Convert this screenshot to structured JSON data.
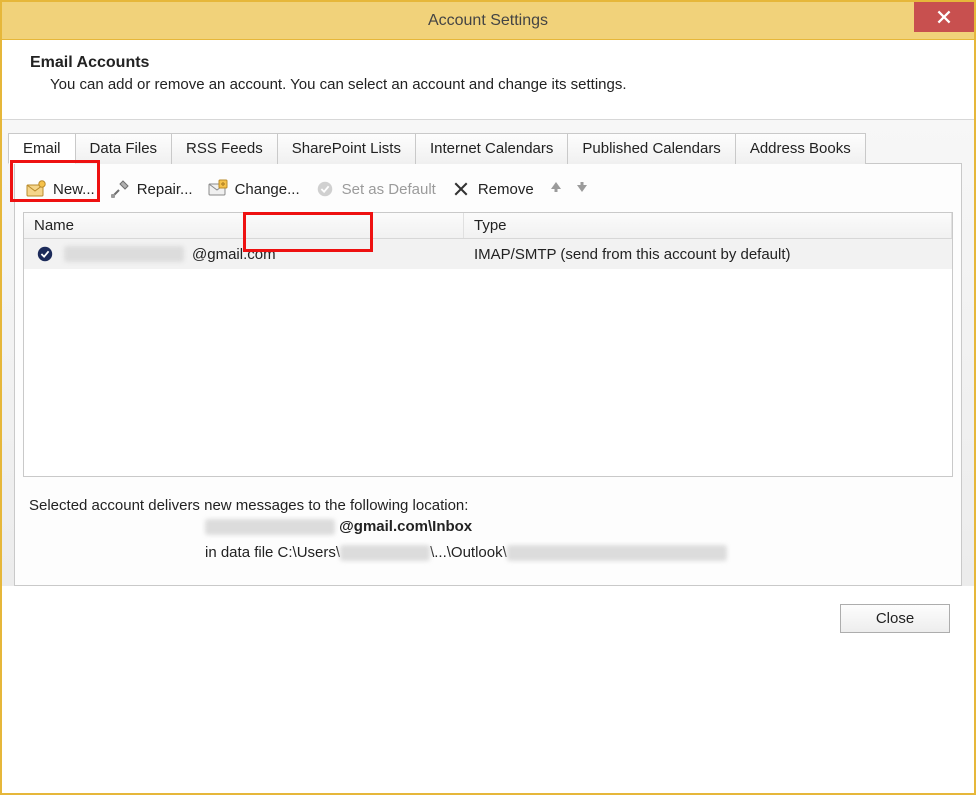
{
  "window": {
    "title": "Account Settings"
  },
  "header": {
    "title": "Email Accounts",
    "subtitle": "You can add or remove an account. You can select an account and change its settings."
  },
  "tabs": [
    {
      "id": "email",
      "label": "Email",
      "active": true
    },
    {
      "id": "data-files",
      "label": "Data Files",
      "active": false
    },
    {
      "id": "rss-feeds",
      "label": "RSS Feeds",
      "active": false
    },
    {
      "id": "sharepoint-lists",
      "label": "SharePoint Lists",
      "active": false
    },
    {
      "id": "internet-calendars",
      "label": "Internet Calendars",
      "active": false
    },
    {
      "id": "published-calendars",
      "label": "Published Calendars",
      "active": false
    },
    {
      "id": "address-books",
      "label": "Address Books",
      "active": false
    }
  ],
  "toolbar": {
    "new_label": "New...",
    "repair_label": "Repair...",
    "change_label": "Change...",
    "set_default_label": "Set as Default",
    "remove_label": "Remove"
  },
  "columns": {
    "name": "Name",
    "type": "Type"
  },
  "accounts": [
    {
      "name_visible_suffix": "@gmail.com",
      "type": "IMAP/SMTP (send from this account by default)",
      "is_default": true
    }
  ],
  "delivery": {
    "intro": "Selected account delivers new messages to the following location:",
    "location_middle": "@gmail.com\\Inbox",
    "datafile_prefix": "in data file C:\\Users\\",
    "datafile_middle": "\\...\\Outlook\\"
  },
  "footer": {
    "close_label": "Close"
  }
}
